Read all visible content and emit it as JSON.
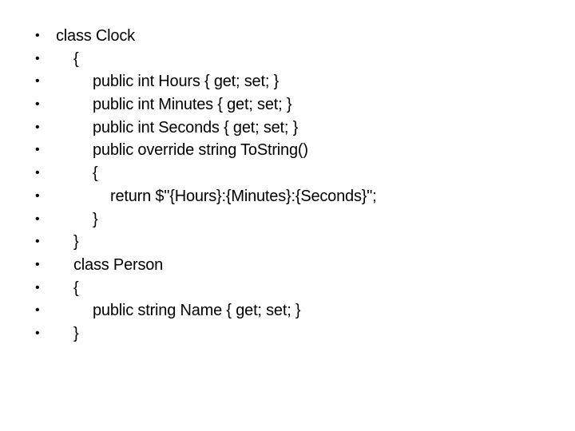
{
  "slide": {
    "bullet_glyph": "•",
    "lines": [
      {
        "text": "class Clock",
        "indent": 0
      },
      {
        "text": "{",
        "indent": 1
      },
      {
        "text": "public int Hours { get; set; }",
        "indent": 2
      },
      {
        "text": "public int Minutes { get; set; }",
        "indent": 2
      },
      {
        "text": "public int Seconds { get; set; }",
        "indent": 2
      },
      {
        "text": "public override string ToString()",
        "indent": 2
      },
      {
        "text": "{",
        "indent": 2
      },
      {
        "text": "return $\"{Hours}:{Minutes}:{Seconds}\";",
        "indent": 3
      },
      {
        "text": "}",
        "indent": 2
      },
      {
        "text": "}",
        "indent": 1
      },
      {
        "text": "class Person",
        "indent": 1
      },
      {
        "text": "{",
        "indent": 1
      },
      {
        "text": "public string Name { get; set; }",
        "indent": 2
      },
      {
        "text": "}",
        "indent": 1
      }
    ]
  }
}
